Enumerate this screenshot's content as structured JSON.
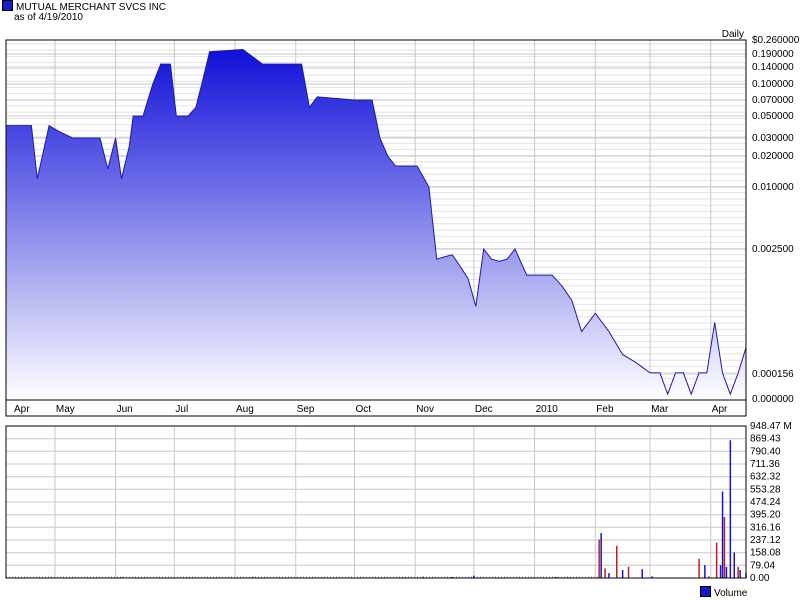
{
  "header": {
    "title": "MUTUAL MERCHANT SVCS INC",
    "asof": "as of 4/19/2010"
  },
  "colors": {
    "fill_top": "#1010d8",
    "fill_bottom": "#ffffff",
    "line": "#1a1aa8",
    "grid": "#c8c8c8",
    "vol_up": "#1515d0",
    "vol_down": "#c02020"
  },
  "chart_data": [
    {
      "type": "area",
      "title": "MUTUAL MERCHANT SVCS INC",
      "frequency": "Daily",
      "y_scale": "log",
      "x": [
        "2009-04-06",
        "2009-04-15",
        "2009-04-19",
        "2009-04-22",
        "2009-04-28",
        "2009-05-03",
        "2009-05-10",
        "2009-05-14",
        "2009-05-18",
        "2009-05-24",
        "2009-05-28",
        "2009-06-01",
        "2009-06-04",
        "2009-06-08",
        "2009-06-10",
        "2009-06-15",
        "2009-06-20",
        "2009-06-24",
        "2009-06-29",
        "2009-07-02",
        "2009-07-05",
        "2009-07-08",
        "2009-07-12",
        "2009-07-15",
        "2009-07-19",
        "2009-08-05",
        "2009-08-15",
        "2009-08-23",
        "2009-08-27",
        "2009-08-30",
        "2009-09-04",
        "2009-09-08",
        "2009-09-12",
        "2009-10-01",
        "2009-10-06",
        "2009-10-10",
        "2009-10-14",
        "2009-10-18",
        "2009-10-22",
        "2009-10-27",
        "2009-11-02",
        "2009-11-08",
        "2009-11-12",
        "2009-11-16",
        "2009-11-20",
        "2009-11-24",
        "2009-11-28",
        "2009-12-02",
        "2009-12-06",
        "2009-12-10",
        "2009-12-14",
        "2009-12-18",
        "2009-12-22",
        "2009-12-28",
        "2010-01-05",
        "2010-01-10",
        "2010-01-15",
        "2010-01-20",
        "2010-01-25",
        "2010-02-01",
        "2010-02-08",
        "2010-02-15",
        "2010-02-22",
        "2010-03-01",
        "2010-03-06",
        "2010-03-10",
        "2010-03-14",
        "2010-03-18",
        "2010-03-22",
        "2010-03-26",
        "2010-03-30",
        "2010-04-03",
        "2010-04-07",
        "2010-04-11",
        "2010-04-15",
        "2010-04-19"
      ],
      "y": [
        0.04,
        0.04,
        0.04,
        0.012,
        0.04,
        0.035,
        0.03,
        0.03,
        0.03,
        0.03,
        0.015,
        0.03,
        0.012,
        0.025,
        0.05,
        0.05,
        0.1,
        0.15,
        0.15,
        0.05,
        0.05,
        0.05,
        0.06,
        0.1,
        0.2,
        0.21,
        0.15,
        0.15,
        0.15,
        0.15,
        0.15,
        0.06,
        0.075,
        0.07,
        0.07,
        0.07,
        0.03,
        0.02,
        0.016,
        0.016,
        0.016,
        0.01,
        0.002,
        0.0021,
        0.0022,
        0.0017,
        0.0013,
        0.0007,
        0.0025,
        0.002,
        0.0019,
        0.002,
        0.0025,
        0.0014,
        0.0014,
        0.0014,
        0.0011,
        0.0008,
        0.0004,
        0.0006,
        0.0004,
        0.00024,
        0.0002,
        0.00016,
        0.00016,
        3e-05,
        0.00016,
        0.00016,
        3e-05,
        0.00016,
        0.00016,
        0.00049,
        0.00016,
        3e-05,
        0.00016,
        0.00028
      ],
      "y_ticks": [
        "$0.260000",
        "0.190000",
        "0.140000",
        "0.100000",
        "0.070000",
        "0.050000",
        "0.030000",
        "0.020000",
        "0.010000",
        "0.002500",
        "0.000156",
        "0.000000"
      ],
      "x_ticks": [
        "Apr",
        "May",
        "Jun",
        "Jul",
        "Aug",
        "Sep",
        "Oct",
        "Nov",
        "Dec",
        "2010",
        "Feb",
        "Mar",
        "Apr"
      ],
      "ylim": [
        0,
        0.26
      ],
      "grid": true
    },
    {
      "type": "bar",
      "title": "Volume",
      "unit": "M",
      "ylim": [
        0,
        948.47
      ],
      "y_ticks": [
        "948.47 M",
        "869.43",
        "790.40",
        "711.36",
        "632.32",
        "553.28",
        "474.24",
        "395.20",
        "316.16",
        "237.12",
        "158.08",
        "79.04",
        "0.00"
      ],
      "series": [
        {
          "name": "Volume",
          "x": [
            "2009-06-04",
            "2009-07-08",
            "2009-08-10",
            "2009-09-15",
            "2009-10-27",
            "2009-11-05",
            "2009-11-20",
            "2009-12-01",
            "2010-01-12",
            "2010-01-18",
            "2010-02-03",
            "2010-02-04",
            "2010-02-06",
            "2010-02-08",
            "2010-02-12",
            "2010-02-15",
            "2010-02-18",
            "2010-02-25",
            "2010-03-02",
            "2010-03-26",
            "2010-03-29",
            "2010-03-31",
            "2010-04-04",
            "2010-04-06",
            "2010-04-07",
            "2010-04-08",
            "2010-04-09",
            "2010-04-11",
            "2010-04-13",
            "2010-04-15",
            "2010-04-16",
            "2010-04-19"
          ],
          "values": [
            5,
            4,
            6,
            4,
            5,
            8,
            6,
            15,
            6,
            5,
            240,
            280,
            60,
            30,
            200,
            50,
            70,
            55,
            10,
            120,
            80,
            10,
            220,
            80,
            540,
            380,
            70,
            860,
            160,
            70,
            50,
            30
          ],
          "direction": [
            "up",
            "up",
            "up",
            "up",
            "up",
            "down",
            "up",
            "up",
            "up",
            "up",
            "down",
            "up",
            "down",
            "up",
            "down",
            "up",
            "down",
            "up",
            "up",
            "down",
            "up",
            "down",
            "down",
            "up",
            "up",
            "down",
            "up",
            "up",
            "up",
            "down",
            "up",
            "up"
          ]
        }
      ]
    }
  ],
  "right_labels": {
    "frequency": "Daily"
  },
  "legend": {
    "label": "Volume"
  }
}
